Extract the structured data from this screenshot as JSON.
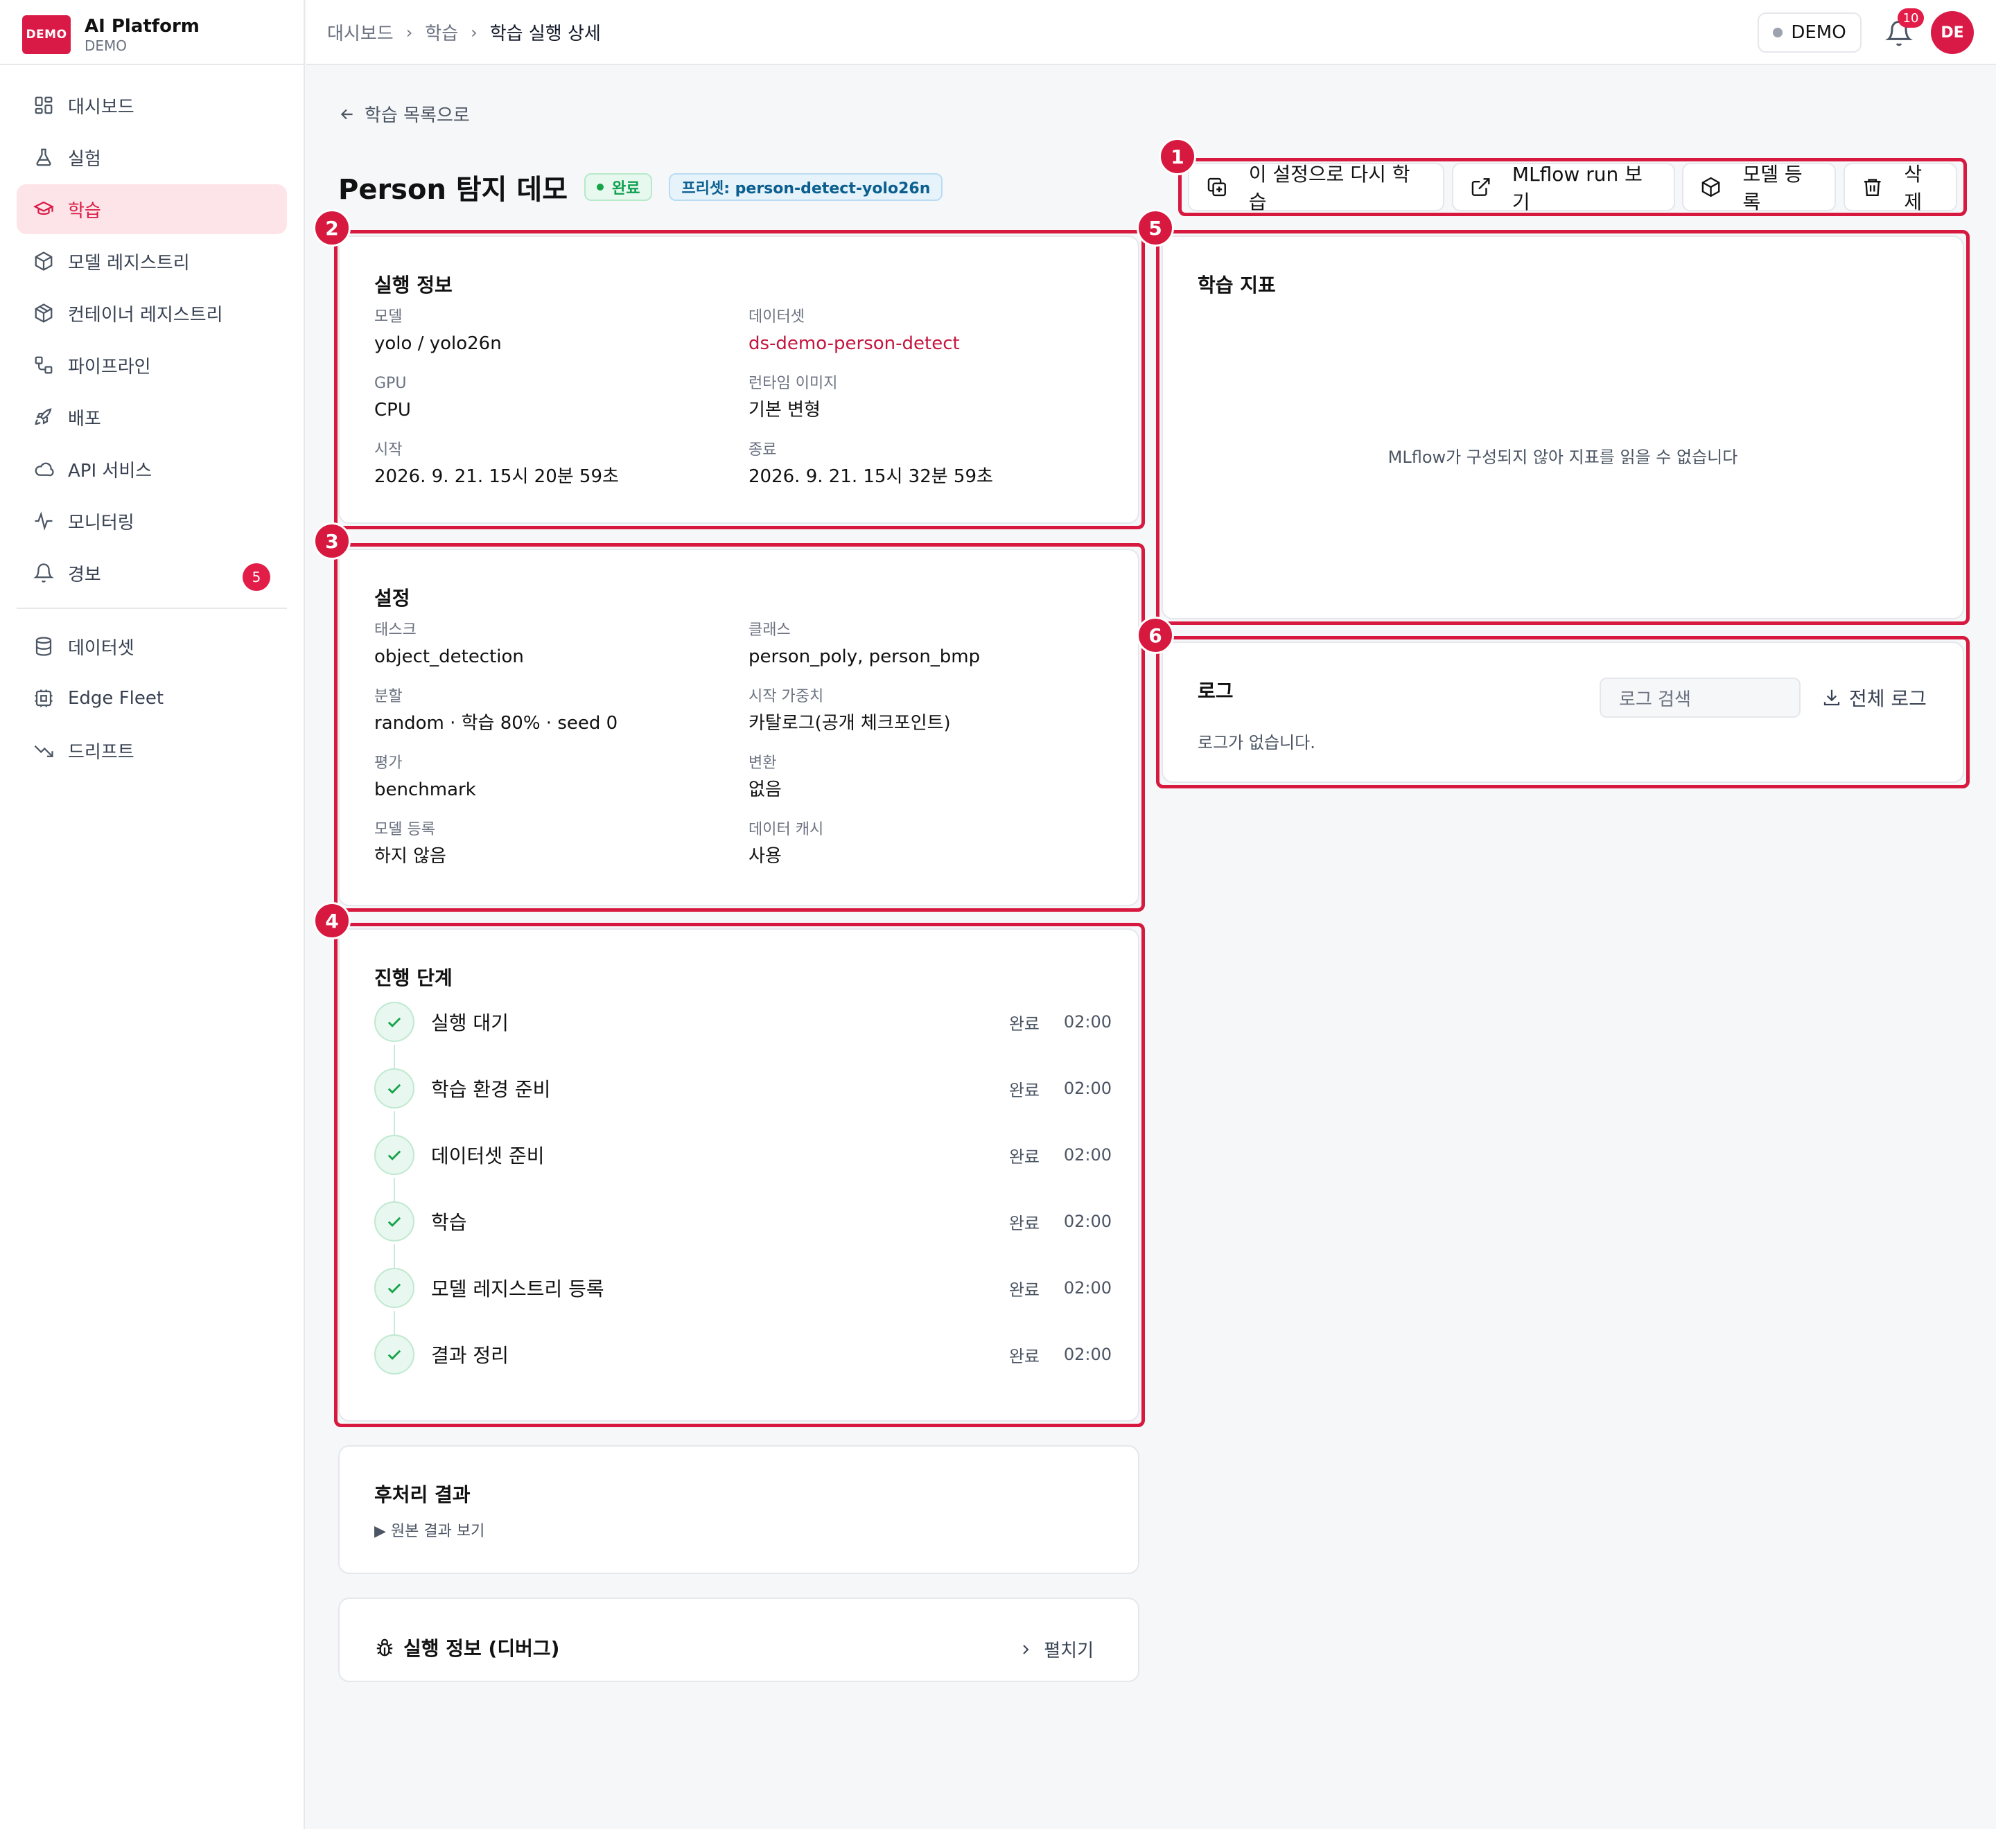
{
  "brand": {
    "logo": "DEMO",
    "title": "AI Platform",
    "subtitle": "DEMO"
  },
  "sidebar": {
    "items": [
      {
        "label": "대시보드",
        "icon": "dashboard-icon"
      },
      {
        "label": "실험",
        "icon": "flask-icon"
      },
      {
        "label": "학습",
        "icon": "graduation-cap-icon",
        "active": true
      },
      {
        "label": "모델 레지스트리",
        "icon": "box-icon"
      },
      {
        "label": "컨테이너 레지스트리",
        "icon": "package-icon"
      },
      {
        "label": "파이프라인",
        "icon": "workflow-icon"
      },
      {
        "label": "배포",
        "icon": "rocket-icon"
      },
      {
        "label": "API 서비스",
        "icon": "cloud-icon"
      },
      {
        "label": "모니터링",
        "icon": "activity-icon"
      },
      {
        "label": "경보",
        "icon": "bell-icon",
        "badge": "5"
      }
    ],
    "items2": [
      {
        "label": "데이터셋",
        "icon": "database-icon"
      },
      {
        "label": "Edge Fleet",
        "icon": "cpu-icon"
      },
      {
        "label": "드리프트",
        "icon": "trend-down-icon"
      }
    ]
  },
  "topbar": {
    "breadcrumb": [
      "대시보드",
      "학습",
      "학습 실행 상세"
    ],
    "env": "DEMO",
    "notifications": "10",
    "avatar": "DE"
  },
  "page": {
    "back": "학습 목록으로",
    "title": "Person 탐지 데모",
    "status": "완료",
    "preset": "프리셋: person-detect-yolo26n"
  },
  "actions": {
    "retrain": "이 설정으로 다시 학습",
    "mlflow": "MLflow run 보기",
    "register": "모델 등록",
    "delete": "삭제"
  },
  "run_info": {
    "title": "실행 정보",
    "fields": [
      {
        "label": "모델",
        "value": "yolo / yolo26n"
      },
      {
        "label": "데이터셋",
        "value": "ds-demo-person-detect"
      },
      {
        "label": "GPU",
        "value": "CPU"
      },
      {
        "label": "런타임 이미지",
        "value": "기본 변형"
      },
      {
        "label": "시작",
        "value": "2026. 9. 21. 15시 20분 59초"
      },
      {
        "label": "종료",
        "value": "2026. 9. 21. 15시 32분 59초"
      }
    ]
  },
  "settings": {
    "title": "설정",
    "fields": [
      {
        "label": "태스크",
        "value": "object_detection"
      },
      {
        "label": "클래스",
        "value": "person_poly, person_bmp"
      },
      {
        "label": "분할",
        "value": "random · 학습 80% · seed 0"
      },
      {
        "label": "시작 가중치",
        "value": "카탈로그(공개 체크포인트)"
      },
      {
        "label": "평가",
        "value": "benchmark"
      },
      {
        "label": "변환",
        "value": "없음"
      },
      {
        "label": "모델 등록",
        "value": "하지 않음"
      },
      {
        "label": "데이터 캐시",
        "value": "사용"
      }
    ]
  },
  "steps": {
    "title": "진행 단계",
    "items": [
      {
        "label": "실행 대기",
        "status": "완료",
        "time": "02:00"
      },
      {
        "label": "학습 환경 준비",
        "status": "완료",
        "time": "02:00"
      },
      {
        "label": "데이터셋 준비",
        "status": "완료",
        "time": "02:00"
      },
      {
        "label": "학습",
        "status": "완료",
        "time": "02:00"
      },
      {
        "label": "모델 레지스트리 등록",
        "status": "완료",
        "time": "02:00"
      },
      {
        "label": "결과 정리",
        "status": "완료",
        "time": "02:00"
      }
    ]
  },
  "metrics": {
    "title": "학습 지표",
    "empty": "MLflow가 구성되지 않아 지표를 읽을 수 없습니다"
  },
  "logs": {
    "title": "로그",
    "search_placeholder": "로그 검색",
    "download": "전체 로그",
    "empty": "로그가 없습니다."
  },
  "post": {
    "title": "후처리 결과",
    "toggle": "▶ 원본 결과 보기"
  },
  "debug": {
    "title": "실행 정보 (디버그)",
    "expand": "펼치기"
  },
  "annotations": [
    "1",
    "2",
    "3",
    "4",
    "5",
    "6"
  ],
  "colors": {
    "accent": "#d91a46",
    "success": "#16a34a",
    "annotation": "#d7193f"
  }
}
